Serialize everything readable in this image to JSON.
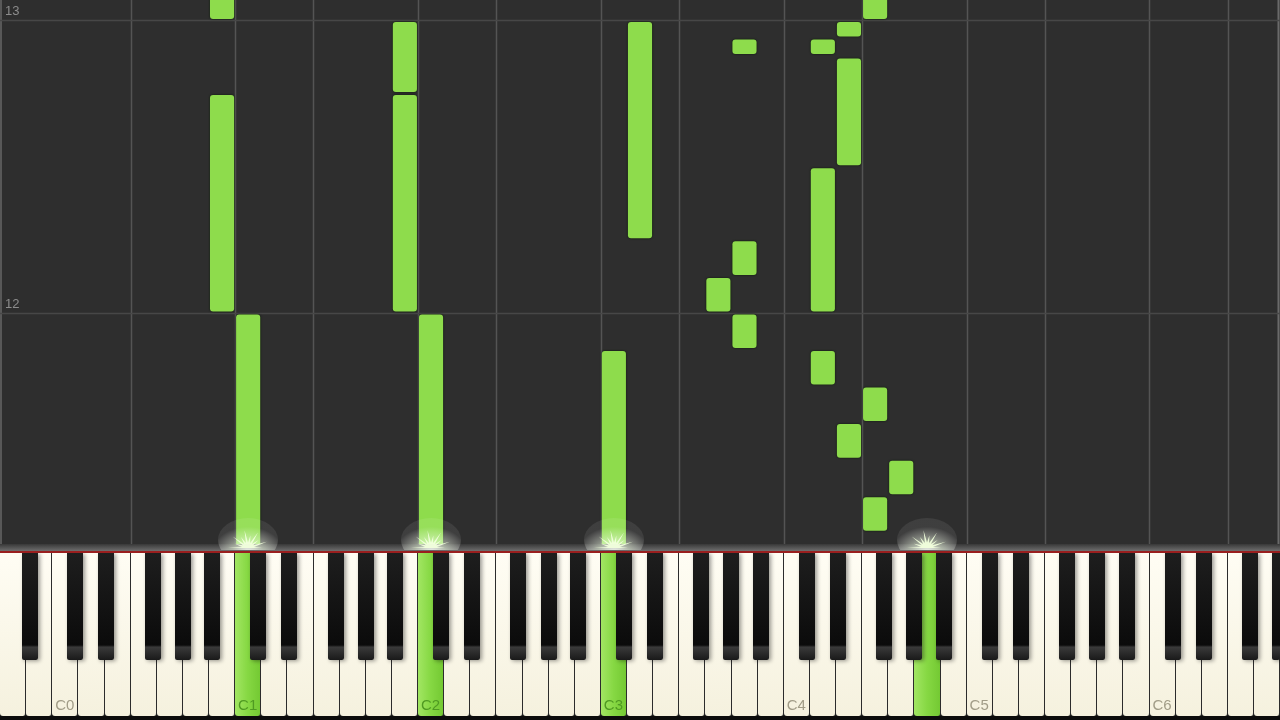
{
  "roll": {
    "chart_data": [
      {
        "type": "bar",
        "categories": [
          null,
          null,
          null,
          null,
          null,
          null,
          null,
          null,
          null,
          null,
          null,
          null,
          null,
          null,
          null,
          null,
          null,
          null,
          null,
          null,
          null,
          null,
          null,
          null,
          null,
          null,
          null,
          null,
          null,
          null,
          null,
          null,
          null,
          null,
          null,
          null,
          null,
          null,
          null,
          null,
          null,
          null,
          null,
          null,
          null,
          null,
          null,
          null,
          null
        ],
        "series": [
          {
            "values": [
              null,
              null,
              null,
              null,
              null,
              null,
              null,
              null,
              0.75,
              1,
              null,
              null,
              null,
              null,
              null,
              0.75,
              1,
              null,
              null,
              null,
              null,
              null,
              null,
              0.875,
              0.75,
              null,
              null,
              0.125,
              0.125,
              null,
              null,
              0.125,
              0.125,
              0.125,
              0.125,
              null,
              null,
              null,
              null,
              null,
              null,
              null,
              null,
              null,
              null,
              null,
              null,
              null,
              null
            ],
            "base": [
              null,
              null,
              null,
              null,
              null,
              null,
              null,
              null,
              12,
              11,
              null,
              null,
              null,
              null,
              null,
              12,
              11,
              null,
              null,
              null,
              null,
              null,
              null,
              11,
              12.25,
              null,
              null,
              12,
              11.875,
              null,
              null,
              11.75,
              11.5,
              11.25,
              11.375,
              null,
              null,
              null,
              null,
              null,
              null,
              null,
              null,
              null,
              null,
              null,
              null,
              null,
              null
            ]
          },
          {
            "values": [
              null,
              null,
              null,
              null,
              null,
              null,
              null,
              null,
              0.25,
              null,
              null,
              null,
              null,
              null,
              null,
              0.25,
              null,
              null,
              null,
              null,
              null,
              null,
              null,
              null,
              null,
              null,
              null,
              null,
              0.125,
              null,
              null,
              0.5,
              0.375,
              0.125,
              null,
              null,
              null,
              null,
              null,
              null,
              null,
              null,
              null,
              null,
              null,
              null,
              null,
              null,
              null
            ],
            "base": [
              null,
              null,
              null,
              null,
              null,
              null,
              null,
              null,
              13,
              null,
              null,
              null,
              null,
              null,
              null,
              12.75,
              null,
              null,
              null,
              null,
              null,
              null,
              null,
              null,
              null,
              null,
              null,
              null,
              12.125,
              null,
              null,
              12,
              12.5,
              11.625,
              null,
              null,
              null,
              null,
              null,
              null,
              null,
              null,
              null,
              null,
              null,
              null,
              null,
              null,
              null
            ]
          },
          {
            "values": [
              null,
              null,
              null,
              null,
              null,
              null,
              null,
              null,
              null,
              null,
              null,
              null,
              null,
              null,
              null,
              null,
              null,
              null,
              null,
              null,
              null,
              null,
              null,
              null,
              null,
              null,
              null,
              null,
              0.06,
              null,
              null,
              0.06,
              0.06,
              0.25,
              null,
              null,
              null,
              null,
              null,
              null,
              null,
              null,
              null,
              null,
              null,
              null,
              null,
              null,
              null
            ],
            "base": [
              null,
              null,
              null,
              null,
              null,
              null,
              null,
              null,
              null,
              null,
              null,
              null,
              null,
              null,
              null,
              null,
              null,
              null,
              null,
              null,
              null,
              null,
              null,
              null,
              null,
              null,
              null,
              null,
              12.88,
              null,
              null,
              12.88,
              12.94,
              13,
              null,
              null,
              null,
              null,
              null,
              null,
              null,
              null,
              null,
              null,
              null,
              null,
              null,
              null,
              null
            ]
          }
        ],
        "color": "#8edc4c",
        "ylim": [
          11.21,
          13.07
        ],
        "yticks": [
          12,
          13
        ],
        "grid": true
      }
    ]
  },
  "keyboard": {
    "white_keys": [
      {
        "pressed": false
      },
      {
        "pressed": false
      },
      {
        "label": "C0",
        "pressed": false
      },
      {
        "pressed": false
      },
      {
        "pressed": false
      },
      {
        "pressed": false
      },
      {
        "pressed": false
      },
      {
        "pressed": false
      },
      {
        "pressed": false
      },
      {
        "label": "C1",
        "pressed": true
      },
      {
        "pressed": false
      },
      {
        "pressed": false
      },
      {
        "pressed": false
      },
      {
        "pressed": false
      },
      {
        "pressed": false
      },
      {
        "pressed": false
      },
      {
        "label": "C2",
        "pressed": true
      },
      {
        "pressed": false
      },
      {
        "pressed": false
      },
      {
        "pressed": false
      },
      {
        "pressed": false
      },
      {
        "pressed": false
      },
      {
        "pressed": false
      },
      {
        "label": "C3",
        "pressed": true
      },
      {
        "pressed": false
      },
      {
        "pressed": false
      },
      {
        "pressed": false
      },
      {
        "pressed": false
      },
      {
        "pressed": false
      },
      {
        "pressed": false
      },
      {
        "label": "C4",
        "pressed": false
      },
      {
        "pressed": false
      },
      {
        "pressed": false
      },
      {
        "pressed": false
      },
      {
        "pressed": false
      },
      {
        "pressed": true
      },
      {
        "pressed": false
      },
      {
        "label": "C5",
        "pressed": false
      },
      {
        "pressed": false
      },
      {
        "pressed": false
      },
      {
        "pressed": false
      },
      {
        "pressed": false
      },
      {
        "pressed": false
      },
      {
        "pressed": false
      },
      {
        "label": "C6",
        "pressed": false
      },
      {
        "pressed": false
      },
      {
        "pressed": false
      },
      {
        "pressed": false
      },
      {
        "pressed": false
      }
    ],
    "black_keys": [
      {
        "pressed": false
      },
      {
        "pressed": false
      },
      {
        "pressed": false
      },
      {
        "pressed": false
      },
      {
        "pressed": false
      },
      {
        "pressed": false
      },
      {
        "pressed": false
      },
      {
        "pressed": false
      },
      {
        "pressed": false
      },
      {
        "pressed": false
      },
      {
        "pressed": false
      },
      {
        "pressed": false
      },
      {
        "pressed": false
      },
      {
        "pressed": false
      },
      {
        "pressed": false
      },
      {
        "pressed": false
      },
      {
        "pressed": false
      },
      {
        "pressed": false
      },
      {
        "pressed": false
      },
      {
        "pressed": false
      },
      {
        "pressed": false
      },
      {
        "pressed": false
      },
      {
        "pressed": false
      },
      {
        "pressed": false
      },
      {
        "pressed": false
      },
      {
        "pressed": false
      },
      {
        "pressed": false
      },
      {
        "pressed": false
      },
      {
        "pressed": false
      },
      {
        "pressed": false
      },
      {
        "pressed": false
      },
      {
        "pressed": false
      },
      {
        "pressed": false
      },
      {
        "pressed": false
      },
      {
        "pressed": false
      }
    ]
  }
}
